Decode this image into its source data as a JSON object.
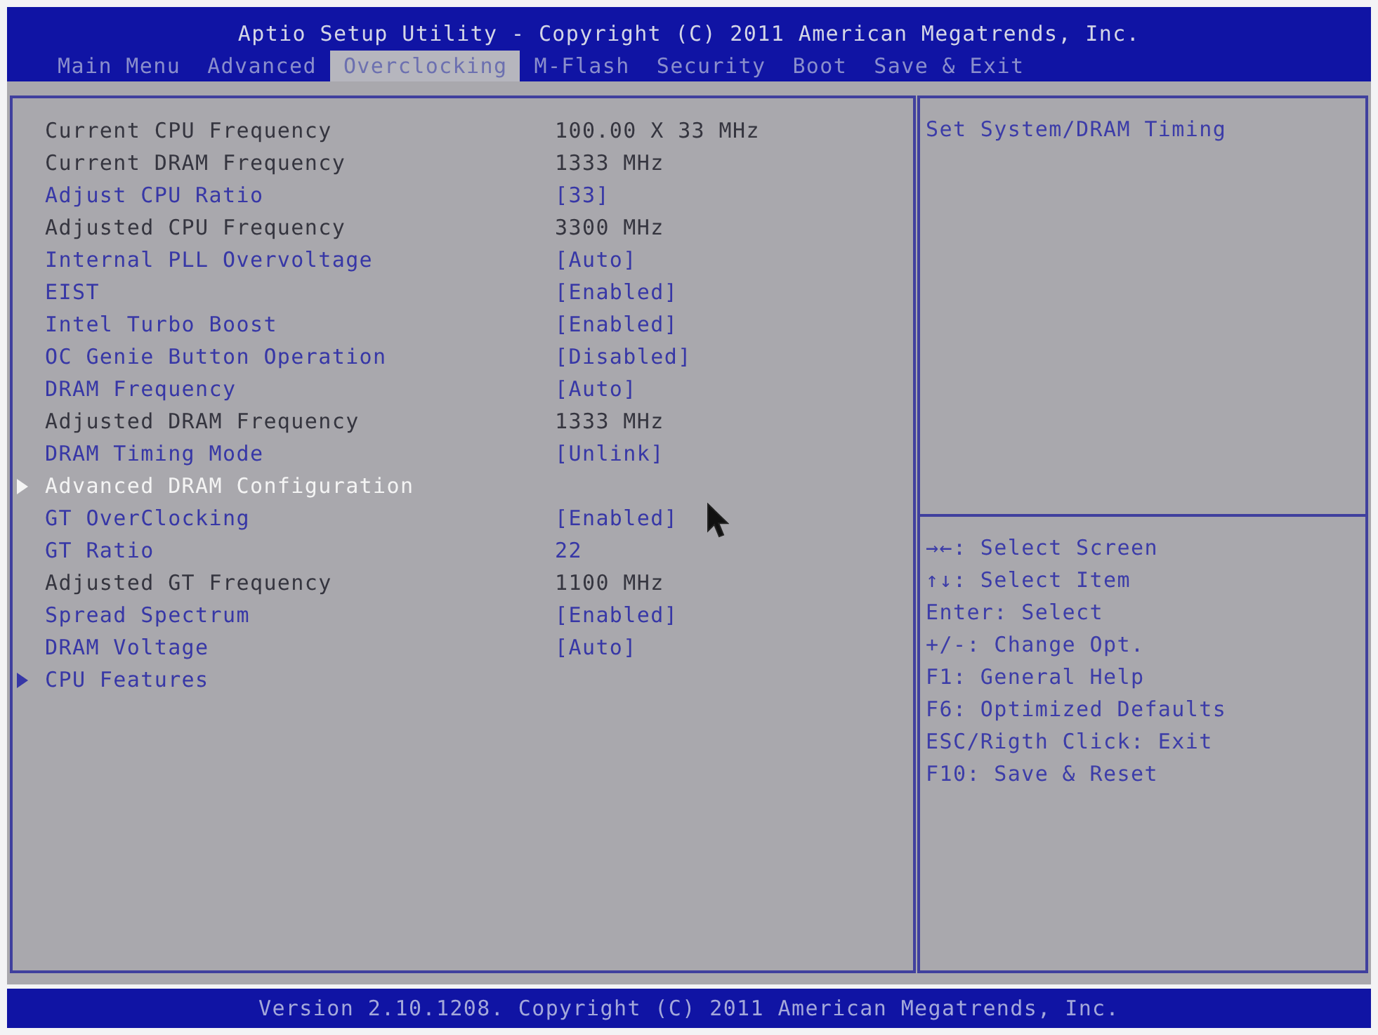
{
  "header": {
    "title": "Aptio Setup Utility - Copyright (C) 2011 American Megatrends, Inc.",
    "tabs": [
      {
        "label": "Main Menu",
        "selected": false
      },
      {
        "label": "Advanced",
        "selected": false
      },
      {
        "label": "Overclocking",
        "selected": true
      },
      {
        "label": "M-Flash",
        "selected": false
      },
      {
        "label": "Security",
        "selected": false
      },
      {
        "label": "Boot",
        "selected": false
      },
      {
        "label": "Save & Exit",
        "selected": false
      }
    ]
  },
  "settings": [
    {
      "kind": "info",
      "label": "Current CPU Frequency",
      "value": "100.00 X 33 MHz",
      "selected": false
    },
    {
      "kind": "info",
      "label": "Current DRAM Frequency",
      "value": "1333 MHz",
      "selected": false
    },
    {
      "kind": "setting",
      "label": "Adjust CPU Ratio",
      "value": "[33]",
      "selected": false
    },
    {
      "kind": "info",
      "label": "Adjusted CPU Frequency",
      "value": "3300 MHz",
      "selected": false
    },
    {
      "kind": "setting",
      "label": "Internal PLL Overvoltage",
      "value": "[Auto]",
      "selected": false
    },
    {
      "kind": "setting",
      "label": "EIST",
      "value": "[Enabled]",
      "selected": false
    },
    {
      "kind": "setting",
      "label": "Intel Turbo Boost",
      "value": "[Enabled]",
      "selected": false
    },
    {
      "kind": "setting",
      "label": "OC Genie Button Operation",
      "value": "[Disabled]",
      "selected": false
    },
    {
      "kind": "setting",
      "label": "DRAM Frequency",
      "value": "[Auto]",
      "selected": false
    },
    {
      "kind": "info",
      "label": "Adjusted DRAM Frequency",
      "value": "1333 MHz",
      "selected": false
    },
    {
      "kind": "setting",
      "label": "DRAM Timing Mode",
      "value": "[Unlink]",
      "selected": false
    },
    {
      "kind": "submenu",
      "label": "Advanced DRAM Configuration",
      "selected": true
    },
    {
      "kind": "setting",
      "label": "GT OverClocking",
      "value": "[Enabled]",
      "selected": false
    },
    {
      "kind": "setting",
      "label": "GT Ratio",
      "value": "22",
      "selected": false
    },
    {
      "kind": "info",
      "label": "Adjusted GT Frequency",
      "value": "1100 MHz",
      "selected": false
    },
    {
      "kind": "setting",
      "label": "Spread Spectrum",
      "value": "[Enabled]",
      "selected": false
    },
    {
      "kind": "setting",
      "label": "DRAM Voltage",
      "value": "[Auto]",
      "selected": false
    },
    {
      "kind": "submenu",
      "label": "CPU Features",
      "selected": false
    }
  ],
  "help": {
    "text": "Set System/DRAM Timing",
    "keys": [
      "→←: Select Screen",
      "↑↓: Select Item",
      "Enter: Select",
      "+/-: Change Opt.",
      "F1: General Help",
      "F6: Optimized Defaults",
      "ESC/Rigth Click: Exit",
      "F10: Save & Reset"
    ]
  },
  "status_bar": {
    "text": "Version 2.10.1208. Copyright (C) 2011 American Megatrends, Inc."
  }
}
